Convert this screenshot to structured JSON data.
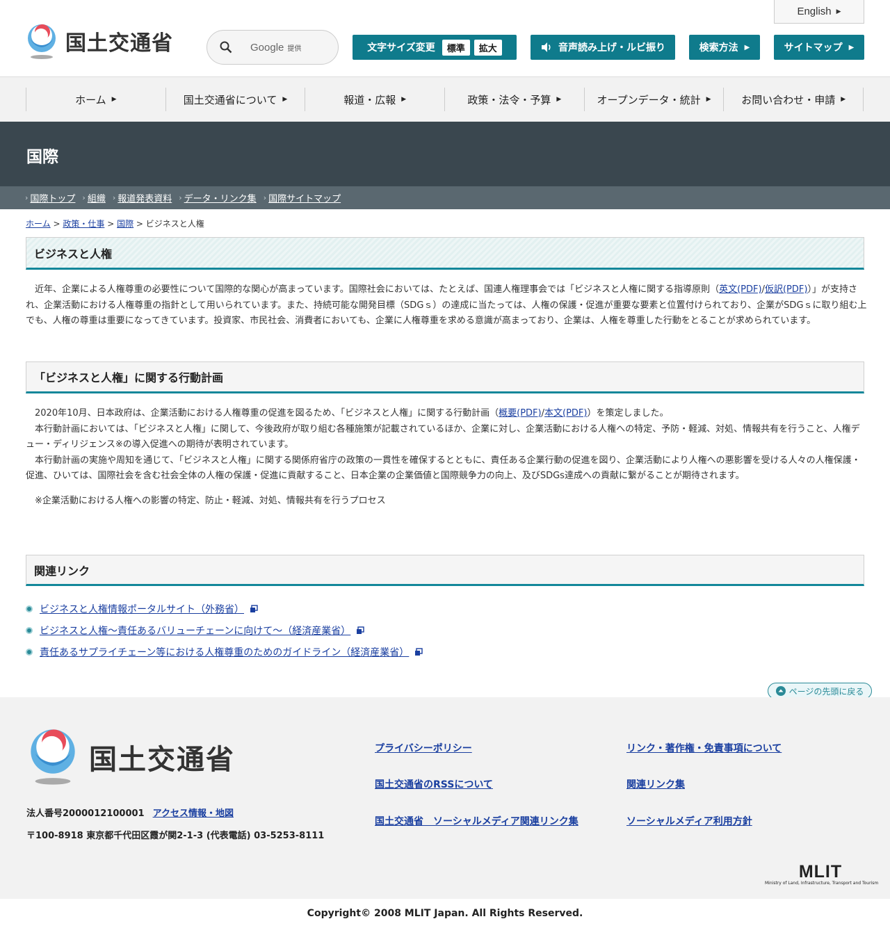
{
  "header": {
    "site_name": "国土交通省",
    "search_brand": "Google",
    "search_provided": "提供",
    "english_label": "English",
    "font_size_label": "文字サイズ変更",
    "font_size_standard": "標準",
    "font_size_large": "拡大",
    "reading_label": "音声読み上げ・ルビ振り",
    "search_method_label": "検索方法",
    "sitemap_label": "サイトマップ",
    "accent_color": "#0f7b8c"
  },
  "gnav": {
    "items": [
      {
        "label": "ホーム"
      },
      {
        "label": "国土交通省について"
      },
      {
        "label": "報道・広報"
      },
      {
        "label": "政策・法令・予算"
      },
      {
        "label": "オープンデータ・統計"
      },
      {
        "label": "お問い合わせ・申請"
      }
    ]
  },
  "category": {
    "title": "国際",
    "subnav": [
      "国際トップ",
      "組織",
      "報道発表資料",
      "データ・リンク集",
      "国際サイトマップ"
    ]
  },
  "breadcrumb": {
    "items": [
      "ホーム",
      "政策・仕事",
      "国際"
    ],
    "current": "ビジネスと人権"
  },
  "main": {
    "title": "ビジネスと人権",
    "intro_a": "　近年、企業による人権尊重の必要性について国際的な関心が高まっています。国際社会においては、たとえば、国連人権理事会では「ビジネスと人権に関する指導原則（",
    "intro_link1": "英文(PDF)",
    "intro_slash": "/",
    "intro_link2": "仮訳(PDF)",
    "intro_b": "）」が支持され、企業活動における人権尊重の指針として用いられています。また、持続可能な開発目標（SDGｓ）の達成に当たっては、人権の保護・促進が重要な要素と位置付けられており、企業がSDGｓに取り組む上でも、人権の尊重は重要になってきています。投資家、市民社会、消費者においても、企業に人権尊重を求める意識が高まっており、企業は、人権を尊重した行動をとることが求められています。",
    "section_title": "「ビジネスと人権」に関する行動計画",
    "plan_a": "　2020年10月、日本政府は、企業活動における人権尊重の促進を図るため、「ビジネスと人権」に関する行動計画（",
    "plan_link1": "概要(PDF)",
    "plan_slash": "/",
    "plan_link2": "本文(PDF)",
    "plan_b": "）を策定しました。",
    "plan_p2": "　本行動計画においては、「ビジネスと人権」に関して、今後政府が取り組む各種施策が記載されているほか、企業に対し、企業活動における人権への特定、予防・軽減、対処、情報共有を行うこと、人権デュー・ディリジェンス※の導入促進への期待が表明されています。",
    "plan_p3": "　本行動計画の実施や周知を通じて、「ビジネスと人権」に関する関係府省庁の政策の一貫性を確保するとともに、責任ある企業行動の促進を図り、企業活動により人権への悪影響を受ける人々の人権保護・促進、ひいては、国際社会を含む社会全体の人権の保護・促進に貢献すること、日本企業の企業価値と国際競争力の向上、及びSDGs達成への貢献に繋がることが期待されます。",
    "plan_note": "　※企業活動における人権への影響の特定、防止・軽減、対処、情報共有を行うプロセス",
    "related_title": "関連リンク",
    "related_links": [
      "ビジネスと人権情報ポータルサイト（外務省）",
      "ビジネスと人権～責任あるバリューチェーンに向けて～（経済産業省）",
      "責任あるサプライチェーン等における人権尊重のためのガイドライン（経済産業省）"
    ]
  },
  "page_top_label": "ページの先頭に戻る",
  "footer": {
    "site_name": "国土交通省",
    "corp_number": "法人番号2000012100001",
    "access_label": "アクセス情報・地図",
    "address": "〒100-8918 東京都千代田区霞が関2-1-3 (代表電話) 03-5253-8111",
    "links_left": [
      "プライバシーポリシー",
      "国土交通省のRSSについて",
      "国土交通省　ソーシャルメディア関連リンク集"
    ],
    "links_right": [
      "リンク・著作権・免責事項について",
      "関連リンク集",
      "ソーシャルメディア利用方針"
    ],
    "mlit_mark": "MLIT",
    "mlit_sub": "Ministry of Land, Infrastructure, Transport and Tourism",
    "copyright": "Copyright© 2008 MLIT Japan. All Rights Reserved."
  }
}
